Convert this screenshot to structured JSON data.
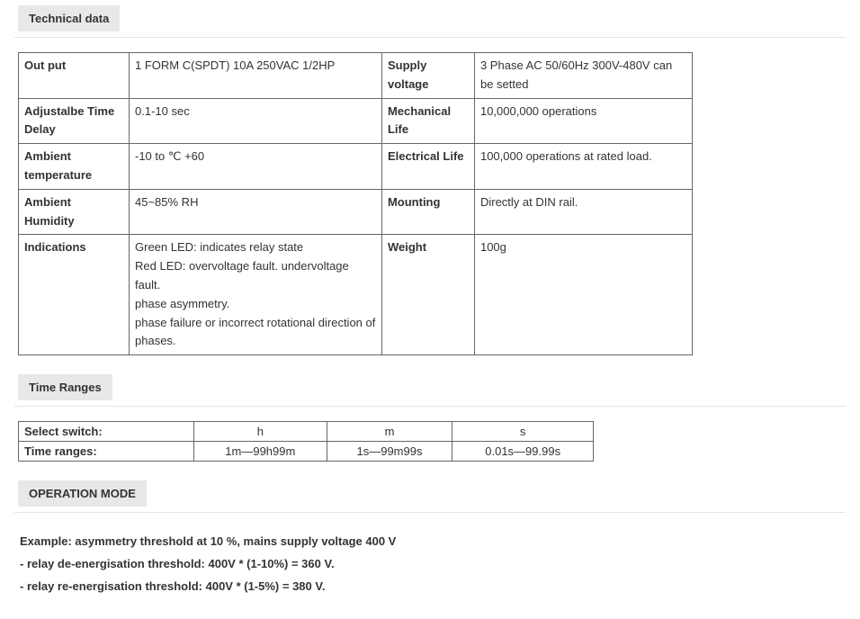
{
  "sections": {
    "tech": "Technical data",
    "time": "Time Ranges",
    "op": "OPERATION MODE"
  },
  "spec": {
    "r1c1k": "Out put",
    "r1c1v": "1 FORM C(SPDT) 10A 250VAC 1/2HP",
    "r1c2k": "Supply voltage",
    "r1c2v": "3 Phase AC 50/60Hz 300V-480V can be setted",
    "r2c1k": "Adjustalbe Time Delay",
    "r2c1v": "0.1-10 sec",
    "r2c2k": "Mechanical Life",
    "r2c2v": "10,000,000 operations",
    "r3c1k": "Ambient temperature",
    "r3c1v": "-10  to ℃ +60",
    "r3c2k": "Electrical Life",
    "r3c2v": "100,000 operations at rated load.",
    "r4c1k": "Ambient Humidity",
    "r4c1v": "45~85% RH",
    "r4c2k": "Mounting",
    "r4c2v": "Directly at DIN rail.",
    "r5c1k": "Indications",
    "r5c1v_l1": "Green LED: indicates relay state",
    "r5c1v_l2": "Red LED: overvoltage fault.    undervoltage fault.",
    "r5c1v_l3": "  phase asymmetry.",
    "r5c1v_l4": "phase failure or incorrect rotational direction of phases.",
    "r5c2k": "Weight",
    "r5c2v": "100g"
  },
  "time": {
    "h1": "Select switch:",
    "h2": "Time ranges:",
    "c1": "h",
    "c2": "m",
    "c3": "s",
    "v1": "1m—99h99m",
    "v2": "1s—99m99s",
    "v3": "0.01s—99.99s"
  },
  "example": {
    "l1": "Example: asymmetry threshold at 10 %, mains supply voltage 400 V",
    "l2": "- relay de-energisation threshold: 400V * (1-10%) = 360 V.",
    "l3": "- relay re-energisation threshold: 400V * (1-5%) = 380 V."
  }
}
